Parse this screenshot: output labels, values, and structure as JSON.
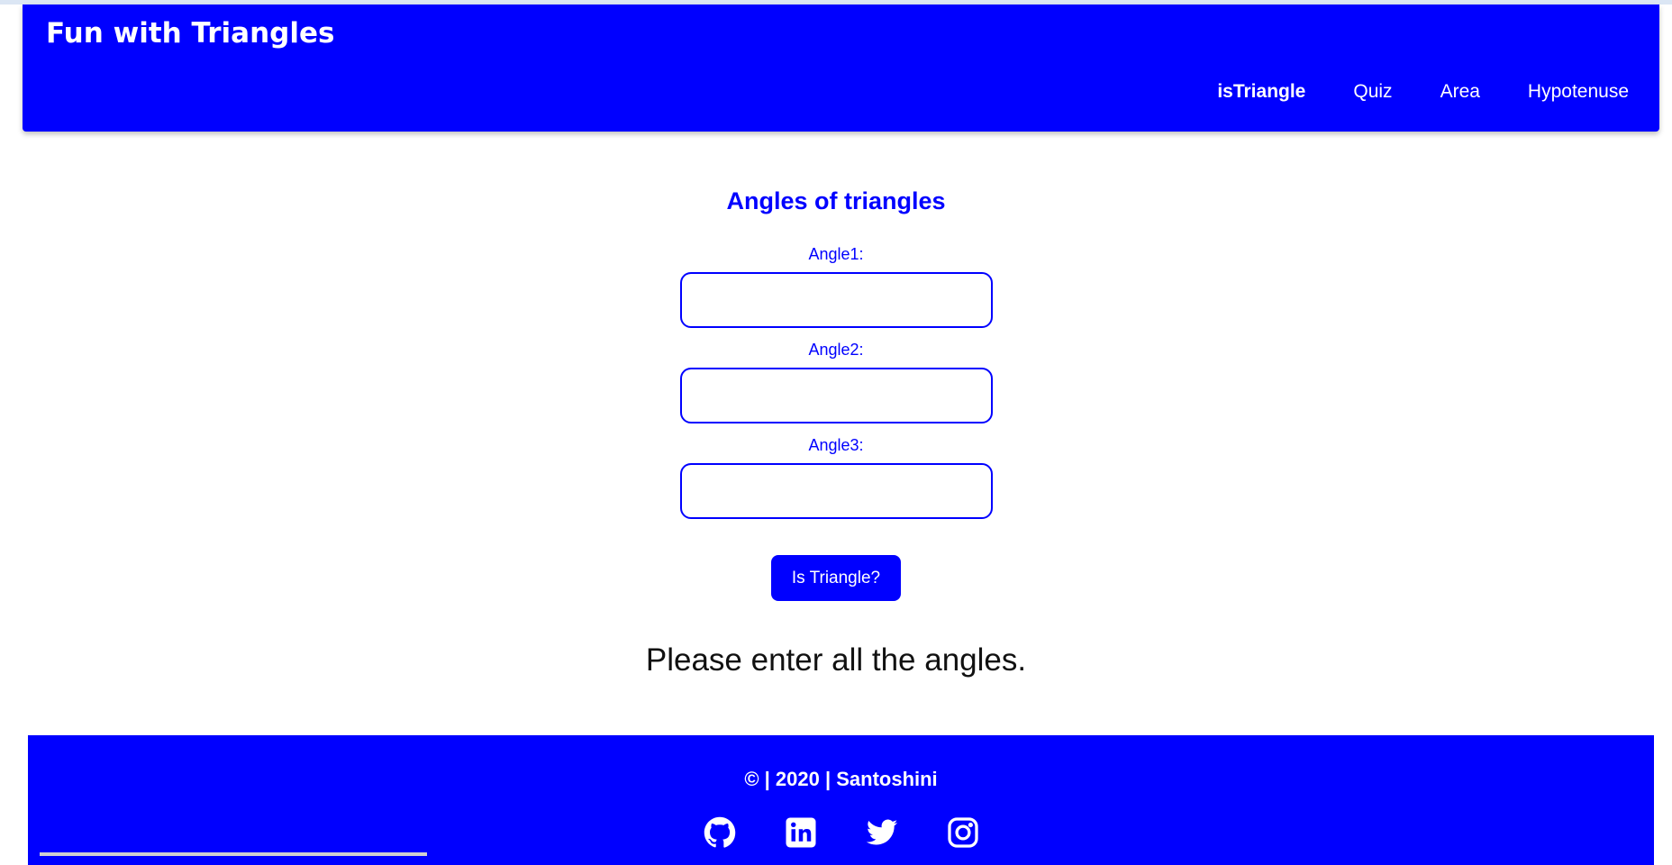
{
  "navbar": {
    "brand": "Fun with Triangles",
    "links": [
      "isTriangle",
      "Quiz",
      "Area",
      "Hypotenuse"
    ]
  },
  "main": {
    "title": "Angles of triangles",
    "fields": [
      {
        "label": "Angle1:",
        "value": ""
      },
      {
        "label": "Angle2:",
        "value": ""
      },
      {
        "label": "Angle3:",
        "value": ""
      }
    ],
    "button_label": "Is Triangle?",
    "result": "Please enter all the angles."
  },
  "footer": {
    "copyright": "© | 2020 | Santoshini",
    "social_icons": [
      "github-icon",
      "linkedin-icon",
      "twitter-icon",
      "instagram-icon"
    ]
  },
  "colors": {
    "accent": "#0000ff",
    "background": "#ffffff",
    "text": "#111111"
  }
}
